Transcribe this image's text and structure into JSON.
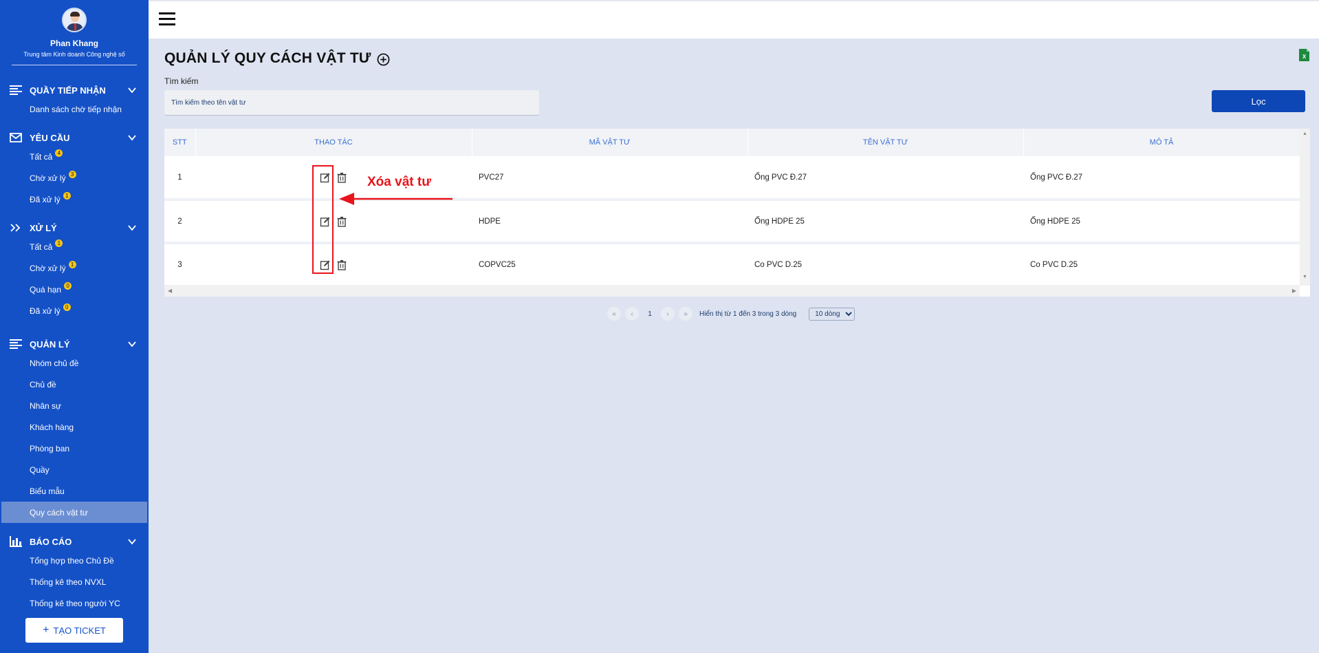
{
  "user": {
    "name": "Phan Khang",
    "unit": "Trung tâm Kinh doanh Công nghệ số"
  },
  "sidebar": {
    "sections": [
      {
        "label": "QUẦY TIẾP NHẬN",
        "icon": "list-icon",
        "items": [
          {
            "label": "Danh sách chờ tiếp nhận"
          }
        ]
      },
      {
        "label": "YÊU CẦU",
        "icon": "mail-icon",
        "items": [
          {
            "label": "Tất cả",
            "badge": "4"
          },
          {
            "label": "Chờ xử lý",
            "badge": "3"
          },
          {
            "label": "Đã xử lý",
            "badge": "1"
          }
        ]
      },
      {
        "label": "XỬ LÝ",
        "icon": "double-chevron-right-icon",
        "items": [
          {
            "label": "Tất cả",
            "badge": "1"
          },
          {
            "label": "Chờ xử lý",
            "badge": "1"
          },
          {
            "label": "Quá hạn",
            "badge": "0"
          },
          {
            "label": "Đã xử lý",
            "badge": "0"
          }
        ]
      },
      {
        "label": "QUẢN LÝ",
        "icon": "list-icon",
        "items": [
          {
            "label": "Nhóm chủ đề"
          },
          {
            "label": "Chủ đề"
          },
          {
            "label": "Nhân sự"
          },
          {
            "label": "Khách hàng"
          },
          {
            "label": "Phòng ban"
          },
          {
            "label": "Quầy"
          },
          {
            "label": "Biểu mẫu"
          },
          {
            "label": "Quy cách vật tư"
          }
        ]
      },
      {
        "label": "BÁO CÁO",
        "icon": "bar-chart-icon",
        "items": [
          {
            "label": "Tổng hợp theo Chủ Đề"
          },
          {
            "label": "Thống kê theo NVXL"
          },
          {
            "label": "Thống kê theo người YC"
          }
        ]
      }
    ],
    "active_item": "Quy cách vật tư",
    "create_button": "TẠO TICKET"
  },
  "page": {
    "title": "QUẢN LÝ QUY CÁCH VẬT TƯ",
    "search_label": "Tìm kiếm",
    "search_placeholder": "Tìm kiếm theo tên vật tư",
    "filter_button": "Lọc"
  },
  "table": {
    "columns": [
      "STT",
      "THAO TÁC",
      "MÃ VẬT TƯ",
      "TÊN VẬT TƯ",
      "MÔ TẢ"
    ],
    "rows": [
      {
        "stt": "1",
        "code": "PVC27",
        "name": "Ống PVC Đ.27",
        "desc": "Ống PVC Đ.27"
      },
      {
        "stt": "2",
        "code": "HDPE",
        "name": "Ống HDPE 25",
        "desc": "Ống HDPE 25"
      },
      {
        "stt": "3",
        "code": "COPVC25",
        "name": "Co PVC D.25",
        "desc": "Co PVC D.25"
      }
    ]
  },
  "pagination": {
    "first": "«",
    "prev": "‹",
    "current": "1",
    "next": "›",
    "last": "»",
    "info": "Hiển thị từ 1 đến 3 trong 3 dòng",
    "page_size": "10 dòng"
  },
  "annotation": {
    "text": "Xóa vật tư",
    "color": "#e8141b"
  },
  "colors": {
    "sidebar": "#1451c7",
    "primary_button": "#0d46b5",
    "background": "#dde3f0"
  }
}
